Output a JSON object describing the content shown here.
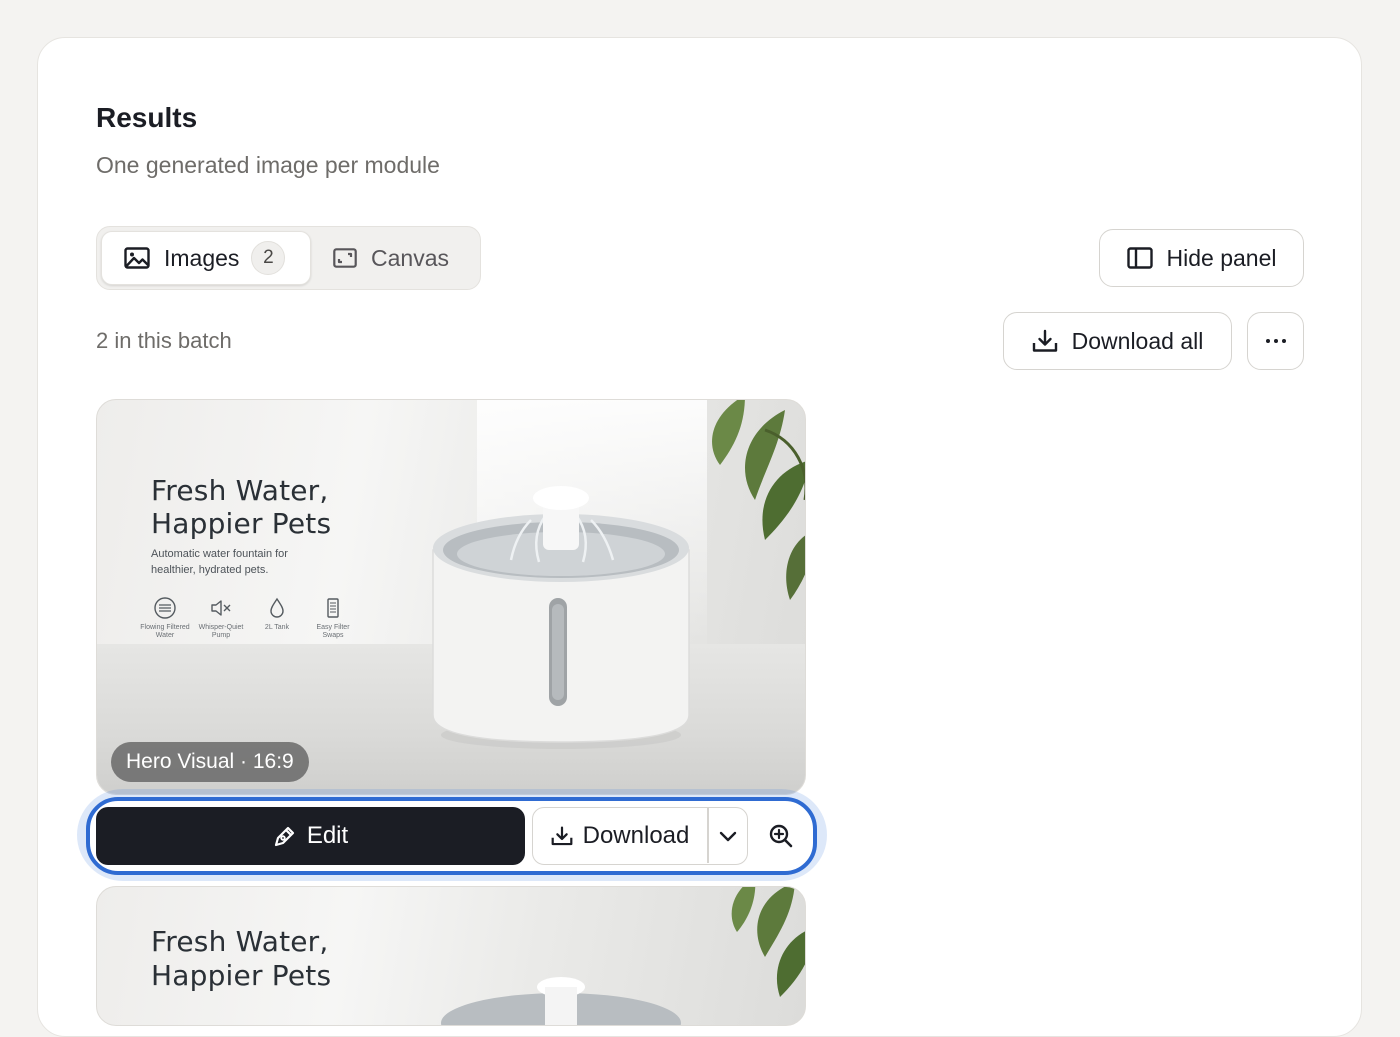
{
  "results": {
    "title": "Results",
    "subtitle": "One generated image per module"
  },
  "tabs": {
    "images": {
      "label": "Images",
      "count": "2",
      "icon": "image-icon"
    },
    "canvas": {
      "label": "Canvas",
      "icon": "canvas-icon"
    }
  },
  "toolbar": {
    "hide_panel_label": "Hide panel",
    "download_all_label": "Download all",
    "more_icon": "more-horizontal-icon"
  },
  "batch": {
    "label": "2 in this batch"
  },
  "cards": [
    {
      "headline_1": "Fresh Water,",
      "headline_2": "Happier Pets",
      "description": "Automatic water fountain for healthier, hydrated pets.",
      "features": [
        {
          "icon": "filter-water-icon",
          "label": "Flowing Filtered Water"
        },
        {
          "icon": "mute-icon",
          "label": "Whisper-Quiet Pump"
        },
        {
          "icon": "water-drop-icon",
          "label": "2L Tank"
        },
        {
          "icon": "filter-icon",
          "label": "Easy Filter Swaps"
        }
      ],
      "chip": "Hero Visual · 16:9"
    },
    {
      "headline_1": "Fresh Water,",
      "headline_2": "Happier Pets"
    }
  ],
  "actions": {
    "edit_label": "Edit",
    "download_label": "Download",
    "edit_icon": "pen-icon",
    "download_icon": "download-icon",
    "dropdown_icon": "chevron-down-icon",
    "zoom_icon": "zoom-in-icon"
  },
  "colors": {
    "background": "#f4f3f1",
    "panel": "#ffffff",
    "primary_button": "#1b1d24",
    "focus_ring": "#2f6bd2"
  }
}
